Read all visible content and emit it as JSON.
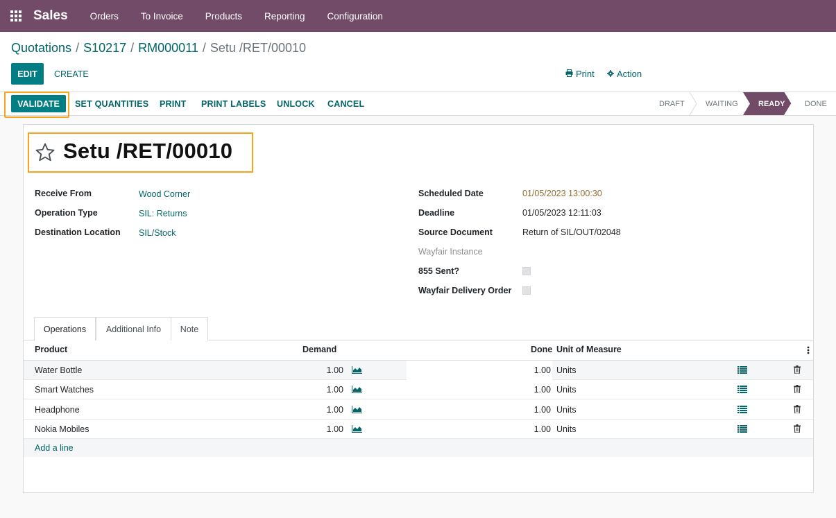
{
  "navbar": {
    "app_name": "Sales",
    "menu": [
      "Orders",
      "To Invoice",
      "Products",
      "Reporting",
      "Configuration"
    ]
  },
  "breadcrumb": {
    "items": [
      "Quotations",
      "S10217",
      "RM000011"
    ],
    "current": "Setu /RET/00010",
    "separator": "/"
  },
  "toolbar": {
    "edit_label": "EDIT",
    "create_label": "CREATE",
    "print_label": "Print",
    "action_label": "Action"
  },
  "statusbar": {
    "buttons": {
      "validate": "VALIDATE",
      "set_quantities": "SET QUANTITIES",
      "print": "PRINT",
      "print_labels": "PRINT LABELS",
      "unlock": "UNLOCK",
      "cancel": "CANCEL"
    },
    "stages": [
      "DRAFT",
      "WAITING",
      "READY",
      "DONE"
    ],
    "active_stage": "READY"
  },
  "record": {
    "title": "Setu /RET/00010",
    "left_fields": [
      {
        "label": "Receive From",
        "value": "Wood Corner"
      },
      {
        "label": "Operation Type",
        "value": "SIL: Returns"
      },
      {
        "label": "Destination Location",
        "value": "SIL/Stock"
      }
    ],
    "right_fields": {
      "scheduled_date": {
        "label": "Scheduled Date",
        "value": "01/05/2023 13:00:30"
      },
      "deadline": {
        "label": "Deadline",
        "value": "01/05/2023 12:11:03"
      },
      "source_document": {
        "label": "Source Document",
        "value": "Return of SIL/OUT/02048"
      },
      "wayfair_instance": {
        "label": "Wayfair Instance",
        "value": ""
      },
      "sent_855": {
        "label": "855 Sent?",
        "checked": false
      },
      "wayfair_delivery_order": {
        "label": "Wayfair Delivery Order",
        "checked": false
      }
    }
  },
  "tabs": [
    "Operations",
    "Additional Info",
    "Note"
  ],
  "active_tab": "Operations",
  "operations": {
    "headers": {
      "product": "Product",
      "demand": "Demand",
      "done": "Done",
      "uom": "Unit of Measure"
    },
    "rows": [
      {
        "product": "Water Bottle",
        "demand": "1.00",
        "done": "1.00",
        "uom": "Units"
      },
      {
        "product": "Smart Watches",
        "demand": "1.00",
        "done": "1.00",
        "uom": "Units"
      },
      {
        "product": "Headphone",
        "demand": "1.00",
        "done": "1.00",
        "uom": "Units"
      },
      {
        "product": "Nokia Mobiles",
        "demand": "1.00",
        "done": "1.00",
        "uom": "Units"
      }
    ],
    "add_line_label": "Add a line"
  },
  "colors": {
    "brand": "#714b67",
    "primary": "#017e84",
    "link": "#01656a",
    "highlight": "#f9a31a"
  },
  "icons": [
    "apps-grid-icon",
    "printer-icon",
    "gear-icon",
    "star-icon",
    "forecast-chart-icon",
    "detailed-list-icon",
    "trash-icon",
    "kebab-icon"
  ]
}
